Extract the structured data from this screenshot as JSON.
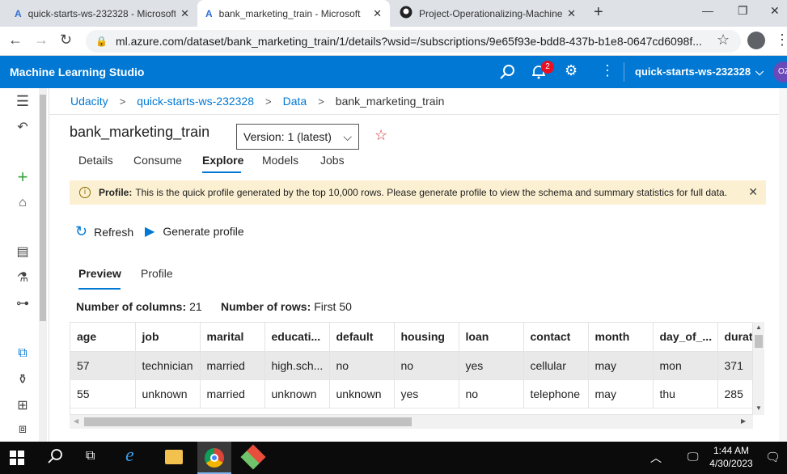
{
  "browser": {
    "tabs": [
      {
        "title": "quick-starts-ws-232328 - Microsoft",
        "icon": "azure-ml-icon",
        "close": "✕"
      },
      {
        "title": "bank_marketing_train - Microsoft",
        "icon": "azure-ml-icon",
        "close": "✕"
      },
      {
        "title": "Project-Operationalizing-Machine",
        "icon": "github-icon",
        "close": "✕"
      }
    ],
    "new_tab": "+",
    "url": "ml.azure.com/dataset/bank_marketing_train/1/details?wsid=/subscriptions/9e65f93e-bdd8-437b-b1e8-0647cd6098f..."
  },
  "header": {
    "app_name": "Machine Learning Studio",
    "notification_count": "2",
    "workspace": "quick-starts-ws-232328",
    "avatar": "OZ"
  },
  "breadcrumb": [
    "Udacity",
    "quick-starts-ws-232328",
    "Data",
    "bank_marketing_train"
  ],
  "dataset": {
    "name": "bank_marketing_train",
    "version": "Version: 1 (latest)"
  },
  "tabs": [
    "Details",
    "Consume",
    "Explore",
    "Models",
    "Jobs"
  ],
  "active_tab": "Explore",
  "banner": {
    "label": "Profile:",
    "text": "This is the quick profile generated by the top 10,000 rows. Please generate profile to view the schema and summary statistics for full data."
  },
  "toolbar": {
    "refresh": "Refresh",
    "generate": "Generate profile"
  },
  "subtabs": [
    "Preview",
    "Profile"
  ],
  "summary": {
    "columns_label": "Number of columns:",
    "columns_value": "21",
    "rows_label": "Number of rows:",
    "rows_value": "First 50"
  },
  "table": {
    "headers": [
      "age",
      "job",
      "marital",
      "educati...",
      "default",
      "housing",
      "loan",
      "contact",
      "month",
      "day_of_...",
      "durati"
    ],
    "rows": [
      [
        "57",
        "technician",
        "married",
        "high.sch...",
        "no",
        "no",
        "yes",
        "cellular",
        "may",
        "mon",
        "371"
      ],
      [
        "55",
        "unknown",
        "married",
        "unknown",
        "unknown",
        "yes",
        "no",
        "telephone",
        "may",
        "thu",
        "285"
      ]
    ]
  },
  "taskbar": {
    "time": "1:44 AM",
    "date": "4/30/2023"
  }
}
